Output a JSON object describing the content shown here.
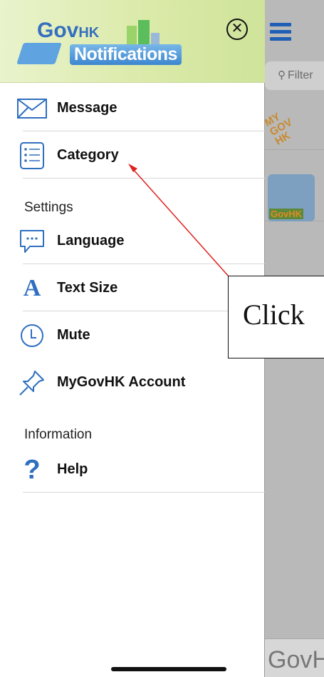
{
  "background": {
    "filter_placeholder": "Filter",
    "bottom_text": "GovHK"
  },
  "header": {
    "logo_gov": "Gov",
    "logo_hk": "HK",
    "logo_notifications": "Notifications"
  },
  "menu": {
    "message": "Message",
    "category": "Category",
    "settings_title": "Settings",
    "language": "Language",
    "text_size": "Text Size",
    "mute": "Mute",
    "account": "MyGovHK Account",
    "information_title": "Information",
    "help": "Help"
  },
  "annotation": {
    "text": "Click"
  },
  "colors": {
    "accent_blue": "#2f6fc0",
    "arrow_red": "#e02020"
  }
}
